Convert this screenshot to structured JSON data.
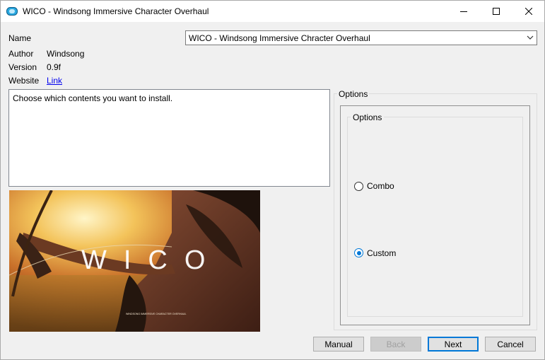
{
  "window": {
    "title": "WICO - Windsong Immersive Character Overhaul",
    "icons": {
      "app": "app-icon",
      "minimize": "minimize-icon",
      "maximize": "maximize-icon",
      "close": "close-icon"
    }
  },
  "info": {
    "name_label": "Name",
    "author_label": "Author",
    "author_value": "Windsong",
    "version_label": "Version",
    "version_value": "0.9f",
    "website_label": "Website",
    "website_link": "Link"
  },
  "name_select": {
    "selected": "WICO - Windsong Immersive Chracter Overhaul",
    "icon": "chevron-down-icon"
  },
  "description": "Choose which contents you want to install.",
  "image": {
    "logo_text": "WICO",
    "caption": "WINDSONG IMMERSIVE CHARACTER OVERHAUL"
  },
  "options": {
    "outer_label": "Options",
    "inner_label": "Options",
    "items": [
      {
        "label": "Combo",
        "checked": false
      },
      {
        "label": "Custom",
        "checked": true
      }
    ]
  },
  "buttons": {
    "manual": "Manual",
    "back": "Back",
    "next": "Next",
    "cancel": "Cancel"
  },
  "colors": {
    "accent": "#0078d7",
    "link": "#0000ee"
  }
}
